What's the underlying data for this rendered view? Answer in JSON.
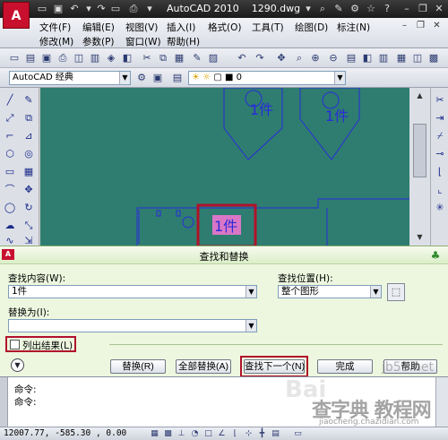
{
  "titlebar": {
    "app_logo": "A",
    "title": "AutoCAD 2010    1290.dwg"
  },
  "menubar": {
    "row1": [
      "文件(F)",
      "编辑(E)",
      "视图(V)",
      "插入(I)",
      "格式(O)",
      "工具(T)",
      "绘图(D)",
      "标注(N)"
    ],
    "row2": [
      "修改(M)",
      "参数(P)",
      "窗口(W)",
      "帮助(H)"
    ]
  },
  "toolbar2": {
    "workspace": "AutoCAD 经典",
    "layer": "0"
  },
  "drawing": {
    "label1": "1件",
    "label2": "1件",
    "label_selected": "1件",
    "colors": {
      "background": "#2e7d70",
      "lines": "#2b2bd9",
      "selection": "#d977c6",
      "highlight_box": "#b0122a"
    }
  },
  "dialog": {
    "title": "查找和替换",
    "find_label": "查找内容(W):",
    "find_value": "1件",
    "find_where_label": "查找位置(H):",
    "find_where_value": "整个图形",
    "replace_label": "替换为(I):",
    "replace_value": "",
    "list_results_label": "列出结果(L)",
    "list_results_checked": false,
    "buttons": {
      "replace": "替换(R)",
      "replace_all": "全部替换(A)",
      "find_next": "查找下一个(N)",
      "done": "完成",
      "help": "帮助"
    }
  },
  "command": {
    "line1": "命令:",
    "line2": "命令:"
  },
  "status": {
    "coords": "12007.77, -585.30 , 0.00"
  },
  "watermarks": {
    "baidu": "Bai",
    "site": "jb51.net",
    "tutorial": "查字典 教程网",
    "url": "jiaocheng.chazidian.com"
  }
}
